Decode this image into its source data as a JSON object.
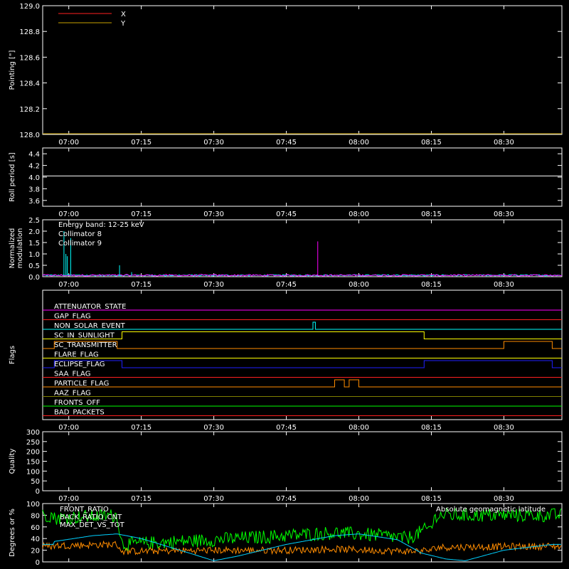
{
  "chart_data": [
    {
      "panel": "pointing",
      "type": "line",
      "ylabel": "Pointing [\"]",
      "ylim": [
        128.0,
        129.0
      ],
      "yticks": [
        "128.0",
        "128.2",
        "128.4",
        "128.6",
        "128.8",
        "129.0"
      ],
      "xticks": [
        "07:00",
        "07:15",
        "07:30",
        "07:45",
        "08:00",
        "08:15",
        "08:30"
      ],
      "legend": [
        "X",
        "Y"
      ],
      "legend_colors": [
        "#ff2020",
        "#c8a000"
      ],
      "series": [
        {
          "name": "X",
          "values": []
        },
        {
          "name": "Y",
          "values": []
        }
      ]
    },
    {
      "panel": "roll",
      "type": "line",
      "ylabel": "Roll period [s]",
      "ylim": [
        3.5,
        4.5
      ],
      "yticks": [
        "3.6",
        "3.8",
        "4.0",
        "4.2",
        "4.4"
      ],
      "xticks": [
        "07:00",
        "07:15",
        "07:30",
        "07:45",
        "08:00",
        "08:15",
        "08:30"
      ],
      "series": [
        {
          "name": "",
          "values": [
            4.02,
            4.02,
            4.02,
            4.02,
            4.02,
            4.03,
            4.02,
            4.02
          ]
        }
      ]
    },
    {
      "panel": "modulation",
      "type": "line",
      "ylabel": "Normalized modulation",
      "ylim": [
        0,
        2.5
      ],
      "yticks": [
        "0.0",
        "0.5",
        "1.0",
        "1.5",
        "2.0",
        "2.5"
      ],
      "xticks": [
        "07:00",
        "07:15",
        "07:30",
        "07:45",
        "08:00",
        "08:15",
        "08:30"
      ],
      "annotation": "Energy band: 12-25 keV",
      "legend": [
        "Collimator 8",
        "Collimator 9"
      ],
      "legend_colors": [
        "#00ffff",
        "#ff00ff"
      ],
      "spikes_c8": [
        [
          -1.0,
          2.0
        ],
        [
          -0.3,
          0.9
        ],
        [
          0.4,
          1.7
        ],
        [
          -0.6,
          1.0
        ],
        [
          10.5,
          0.5
        ],
        [
          13.0,
          0.2
        ]
      ],
      "spikes_c9": [
        [
          51.5,
          1.55
        ],
        [
          5.0,
          0.1
        ],
        [
          30.0,
          0.1
        ]
      ]
    },
    {
      "panel": "flags",
      "type": "line",
      "ylabel": "Flags",
      "xticks": [
        "07:00",
        "07:15",
        "07:30",
        "07:45",
        "08:00",
        "08:15",
        "08:30"
      ],
      "flags": [
        {
          "name": "ATTENUATOR_STATE",
          "color": "#ff00ff",
          "segments": []
        },
        {
          "name": "GAP_FLAG",
          "color": "#ff2020",
          "segments": []
        },
        {
          "name": "NON_SOLAR_EVENT",
          "color": "#00ffff",
          "segments": [
            [
              50.5,
              51.0
            ]
          ]
        },
        {
          "name": "SC_IN_SUNLIGHT",
          "color": "#ffff00",
          "segments": [
            [
              11.0,
              73.5
            ]
          ]
        },
        {
          "name": "SC_TRANSMITTER",
          "color": "#ff8c00",
          "segments": [
            [
              -3.0,
              10.0
            ],
            [
              90.0,
              100.0
            ]
          ]
        },
        {
          "name": "FLARE_FLAG",
          "color": "#ffff00",
          "segments": []
        },
        {
          "name": "ECLIPSE_FLAG",
          "color": "#2020ff",
          "segments": [
            [
              -3.0,
              11.0
            ],
            [
              73.5,
              100.0
            ]
          ]
        },
        {
          "name": "SAA_FLAG",
          "color": "#ff2020",
          "segments": []
        },
        {
          "name": "PARTICLE_FLAG",
          "color": "#ff8c00",
          "segments": [
            [
              55.0,
              57.0
            ],
            [
              58.0,
              60.0
            ]
          ]
        },
        {
          "name": "AAZ_FLAG",
          "color": "#808000",
          "segments": []
        },
        {
          "name": "FRONTS_OFF",
          "color": "#00ff00",
          "segments": []
        },
        {
          "name": "BAD_PACKETS",
          "color": "#ff2020",
          "segments": []
        }
      ]
    },
    {
      "panel": "quality",
      "type": "line",
      "ylabel": "Quality",
      "ylim": [
        0,
        300
      ],
      "yticks": [
        "0",
        "50",
        "100",
        "150",
        "200",
        "250",
        "300"
      ],
      "xticks": [
        "07:00",
        "07:15",
        "07:30",
        "07:45",
        "08:00",
        "08:15",
        "08:30"
      ],
      "series": [
        {
          "name": "",
          "values": []
        }
      ]
    },
    {
      "panel": "degrees",
      "type": "line",
      "ylabel": "Degrees or %",
      "ylim": [
        0,
        100
      ],
      "yticks": [
        "0",
        "20",
        "40",
        "60",
        "80",
        "100"
      ],
      "legend": [
        "FRONT_RATIO",
        "BACK_RATIO_CNT",
        "MAX_DET_VS_TOT"
      ],
      "legend_colors": [
        "#00ff00",
        "#ffff00",
        "#ff8c00"
      ],
      "annotation": "Absolute geomagnetic latitude",
      "annotation_color": "#00d0ff",
      "front_ratio": [
        [
          -3,
          75
        ],
        [
          10,
          80
        ],
        [
          11,
          30
        ],
        [
          30,
          38
        ],
        [
          45,
          45
        ],
        [
          55,
          50
        ],
        [
          65,
          45
        ],
        [
          70,
          40
        ],
        [
          75,
          60
        ],
        [
          76,
          80
        ],
        [
          100,
          80
        ]
      ],
      "max_det": [
        [
          -3,
          28
        ],
        [
          10,
          30
        ],
        [
          11,
          18
        ],
        [
          30,
          20
        ],
        [
          45,
          20
        ],
        [
          55,
          22
        ],
        [
          70,
          18
        ],
        [
          75,
          20
        ],
        [
          76,
          25
        ],
        [
          100,
          27
        ]
      ],
      "geomag": [
        [
          -3,
          35
        ],
        [
          5,
          45
        ],
        [
          10,
          48
        ],
        [
          15,
          40
        ],
        [
          25,
          15
        ],
        [
          30,
          2
        ],
        [
          35,
          10
        ],
        [
          45,
          30
        ],
        [
          55,
          45
        ],
        [
          60,
          48
        ],
        [
          68,
          38
        ],
        [
          73,
          15
        ],
        [
          78,
          5
        ],
        [
          82,
          2
        ],
        [
          90,
          20
        ],
        [
          100,
          30
        ]
      ]
    }
  ]
}
